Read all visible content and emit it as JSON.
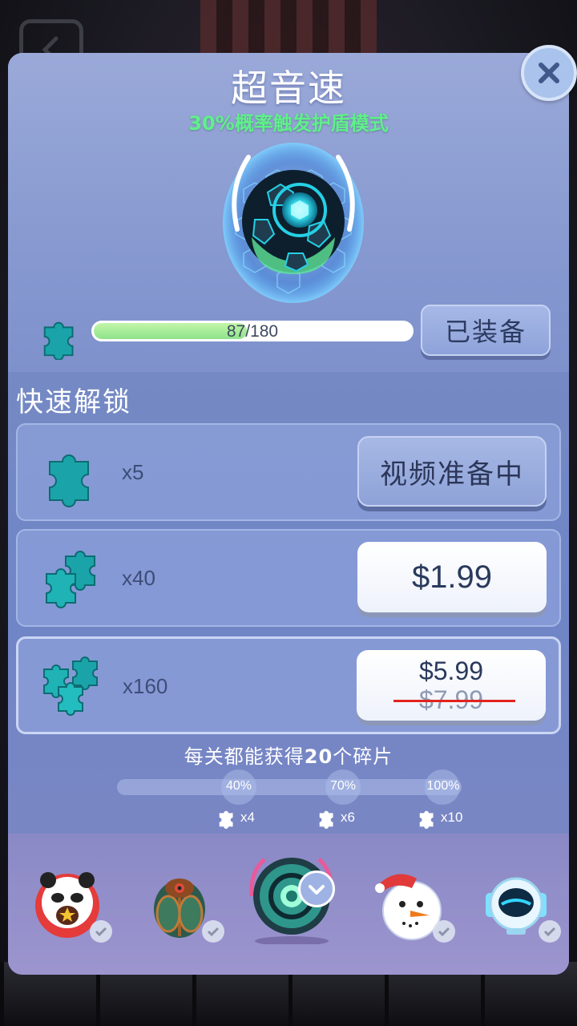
{
  "dialog": {
    "title": "超音速",
    "subtitle": "30%概率触发护盾模式",
    "progress": {
      "text": "87/180",
      "value": 87,
      "max": 180
    },
    "equip_label": "已装备"
  },
  "quick_unlock": {
    "title": "快速解锁",
    "options": [
      {
        "qty": "x5",
        "button": "视频准备中"
      },
      {
        "qty": "x40",
        "price": "$1.99"
      },
      {
        "qty": "x160",
        "price": "$5.99",
        "old_price": "$7.99"
      }
    ]
  },
  "daily": {
    "text_pre": "每关都能获得",
    "text_num": "20",
    "text_post": "个碎片",
    "milestones": [
      {
        "label": "40%",
        "reward": "x4"
      },
      {
        "label": "70%",
        "reward": "x6"
      },
      {
        "label": "100%",
        "reward": "x10"
      }
    ]
  },
  "carousel": {
    "items": [
      "panda-ball-icon",
      "scarab-ball-icon",
      "supersonic-ball-icon",
      "snowman-ball-icon",
      "robot-ball-icon"
    ],
    "selected_index": 2
  },
  "colors": {
    "accent_green": "#5ff08a",
    "panel": "#7589c4",
    "strike": "#e2231f"
  }
}
